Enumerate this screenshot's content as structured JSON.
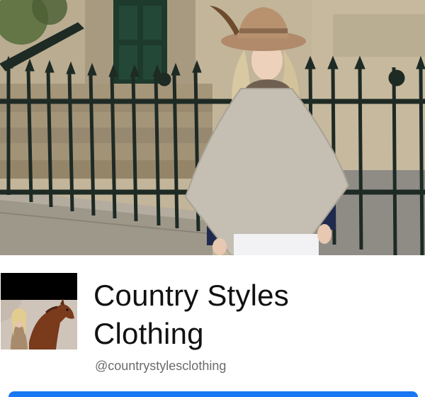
{
  "profile": {
    "name_line1": "Country Styles",
    "name_line2": "Clothing",
    "handle": "@countrystylesclothing"
  },
  "images": {
    "cover": "woman-in-grey-poncho-and-fedora-by-iron-railings-photo",
    "avatar": "woman-with-chestnut-horse-photo"
  },
  "colors": {
    "accent": "#1877f2",
    "name_text": "#111111",
    "handle_text": "#6b6b6b"
  }
}
